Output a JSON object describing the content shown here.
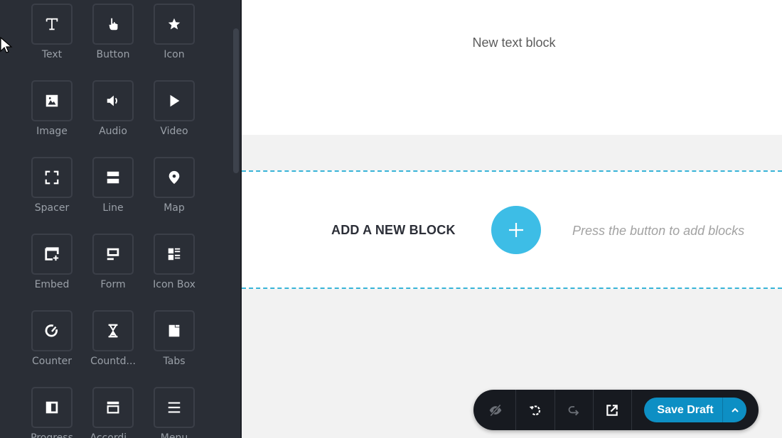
{
  "sidebar": {
    "widgets": [
      {
        "label": "Text",
        "icon": "text-icon"
      },
      {
        "label": "Button",
        "icon": "hand-pointer-icon"
      },
      {
        "label": "Icon",
        "icon": "star-icon"
      },
      {
        "label": "Image",
        "icon": "image-icon"
      },
      {
        "label": "Audio",
        "icon": "speaker-icon"
      },
      {
        "label": "Video",
        "icon": "play-icon"
      },
      {
        "label": "Spacer",
        "icon": "spacer-icon"
      },
      {
        "label": "Line",
        "icon": "line-icon"
      },
      {
        "label": "Map",
        "icon": "map-pin-icon"
      },
      {
        "label": "Embed",
        "icon": "embed-icon"
      },
      {
        "label": "Form",
        "icon": "form-icon"
      },
      {
        "label": "Icon Box",
        "icon": "icon-box-icon"
      },
      {
        "label": "Counter",
        "icon": "gauge-icon"
      },
      {
        "label": "Countd...",
        "icon": "hourglass-icon"
      },
      {
        "label": "Tabs",
        "icon": "folder-tab-icon"
      },
      {
        "label": "Progress",
        "icon": "progress-icon"
      },
      {
        "label": "Accordi...",
        "icon": "accordion-icon"
      },
      {
        "label": "Menu",
        "icon": "menu-icon"
      }
    ]
  },
  "canvas": {
    "text_block": "New text block",
    "add_block": {
      "title": "ADD A NEW BLOCK",
      "hint": "Press the button to add blocks",
      "button_icon": "plus-icon"
    }
  },
  "toolbar": {
    "buttons": [
      {
        "name": "hide-icon"
      },
      {
        "name": "undo-icon"
      },
      {
        "name": "redo-icon"
      },
      {
        "name": "preview-external-icon"
      }
    ],
    "save_label": "Save Draft",
    "menu_icon": "chevron-up-icon"
  },
  "colors": {
    "accent": "#3dbde6",
    "save": "#0d8fc4",
    "sidebar_bg": "#2a2e36",
    "dashed_border": "#38b4d8"
  }
}
